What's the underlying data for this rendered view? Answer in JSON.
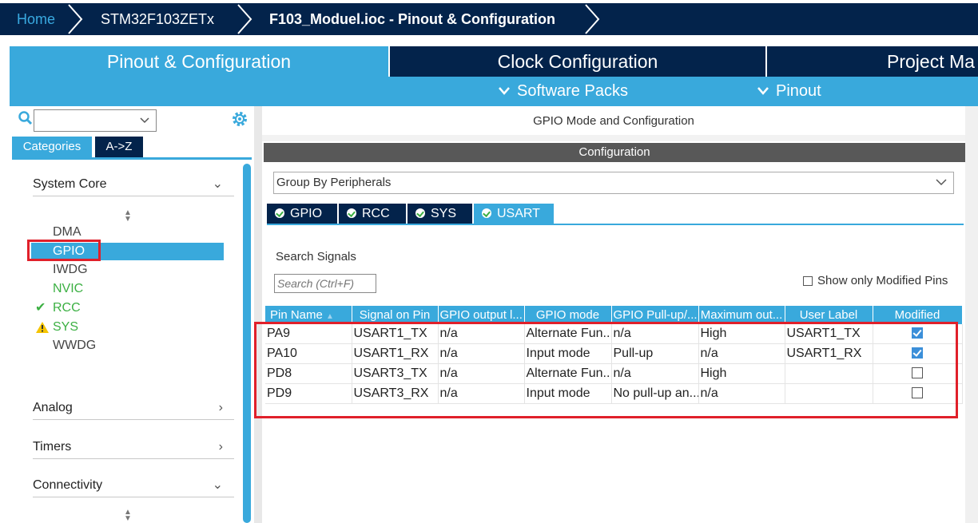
{
  "breadcrumb": {
    "home": "Home",
    "device": "STM32F103ZETx",
    "current": "F103_Moduel.ioc - Pinout & Configuration"
  },
  "main_tabs": [
    "Pinout & Configuration",
    "Clock Configuration",
    "Project Ma"
  ],
  "sub_menu": {
    "software_packs": "Software Packs",
    "pinout": "Pinout"
  },
  "left": {
    "search_value": "",
    "category_tabs": [
      "Categories",
      "A->Z"
    ],
    "groups": {
      "system_core": "System Core",
      "analog": "Analog",
      "timers": "Timers",
      "connectivity": "Connectivity"
    },
    "system_core_items": [
      "DMA",
      "GPIO",
      "IWDG",
      "NVIC",
      "RCC",
      "SYS",
      "WWDG"
    ]
  },
  "right": {
    "title": "GPIO Mode and Configuration",
    "config_header": "Configuration",
    "group_select": "Group By Peripherals",
    "peripheral_tabs": [
      "GPIO",
      "RCC",
      "SYS",
      "USART"
    ],
    "search_label": "Search Signals",
    "search_placeholder": "Search (Ctrl+F)",
    "show_modified": "Show only Modified Pins",
    "table": {
      "headers": [
        "Pin Name",
        "Signal on Pin",
        "GPIO output l...",
        "GPIO mode",
        "GPIO Pull-up/...",
        "Maximum out...",
        "User Label",
        "Modified"
      ],
      "rows": [
        {
          "pin": "PA9",
          "signal": "USART1_TX",
          "output": "n/a",
          "mode": "Alternate Fun...",
          "pull": "n/a",
          "speed": "High",
          "label": "USART1_TX",
          "modified": true
        },
        {
          "pin": "PA10",
          "signal": "USART1_RX",
          "output": "n/a",
          "mode": "Input mode",
          "pull": "Pull-up",
          "speed": "n/a",
          "label": "USART1_RX",
          "modified": true
        },
        {
          "pin": "PD8",
          "signal": "USART3_TX",
          "output": "n/a",
          "mode": "Alternate Fun...",
          "pull": "n/a",
          "speed": "High",
          "label": "",
          "modified": false
        },
        {
          "pin": "PD9",
          "signal": "USART3_RX",
          "output": "n/a",
          "mode": "Input mode",
          "pull": "No pull-up an...",
          "speed": "n/a",
          "label": "",
          "modified": false
        }
      ]
    }
  },
  "colors": {
    "navy": "#03234b",
    "accent": "#39a9dc",
    "green": "#3cb043",
    "highlight": "#e0202a"
  }
}
